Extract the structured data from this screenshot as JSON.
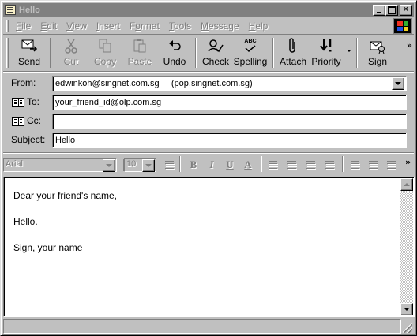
{
  "window": {
    "title": "Hello",
    "app_icon": "note-icon"
  },
  "menu": [
    "File",
    "Edit",
    "View",
    "Insert",
    "Format",
    "Tools",
    "Message",
    "Help"
  ],
  "menu_mnemonics": [
    "F",
    "E",
    "V",
    "I",
    "o",
    "T",
    "M",
    "H"
  ],
  "toolbar": {
    "send": "Send",
    "cut": "Cut",
    "copy": "Copy",
    "paste": "Paste",
    "undo": "Undo",
    "check": "Check",
    "spelling": "Spelling",
    "spelling_badge": "ABC",
    "attach": "Attach",
    "priority": "Priority",
    "sign": "Sign",
    "more": "»"
  },
  "header": {
    "from_label": "From:",
    "from_value": "edwinkoh@singnet.com.sg     (pop.singnet.com.sg)",
    "to_label": "To:",
    "to_value": "your_friend_id@olp.com.sg",
    "cc_label": "Cc:",
    "cc_value": "",
    "subject_label": "Subject:",
    "subject_value": "Hello"
  },
  "format": {
    "font": "Arial",
    "size": "10",
    "bold": "B",
    "italic": "I",
    "underline": "U",
    "color": "A",
    "more": "»"
  },
  "message": {
    "line1": "Dear your friend's name,",
    "line2": "Hello.",
    "line3": "Sign, your name"
  }
}
